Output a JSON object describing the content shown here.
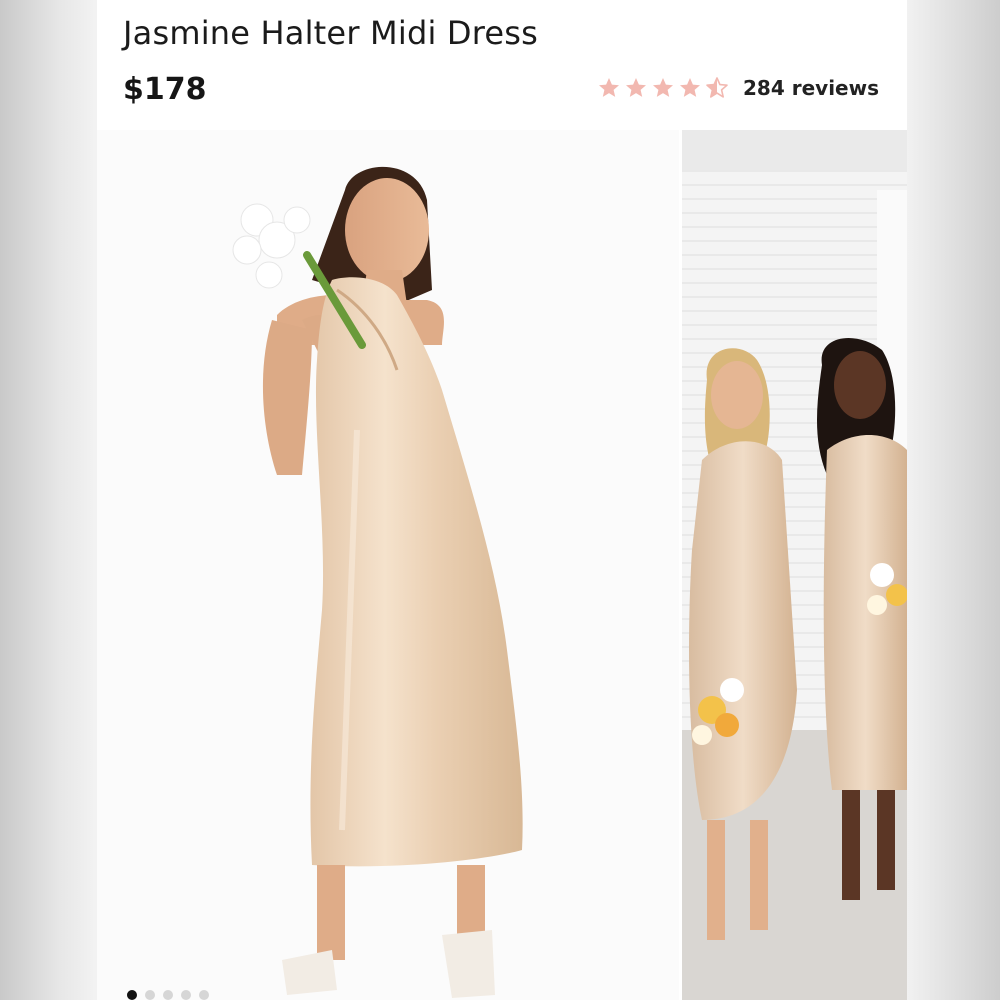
{
  "product": {
    "title": "Jasmine Halter Midi Dress",
    "price": "$178",
    "rating": 4.5,
    "reviews_label": "284 reviews",
    "star_color": "#f2b8b0"
  },
  "gallery": {
    "images": [
      {
        "name": "model-front-photo",
        "icon": "product-photo"
      },
      {
        "name": "bridesmaids-photo",
        "icon": "product-photo"
      }
    ],
    "active_index": 0,
    "dot_count": 5
  }
}
